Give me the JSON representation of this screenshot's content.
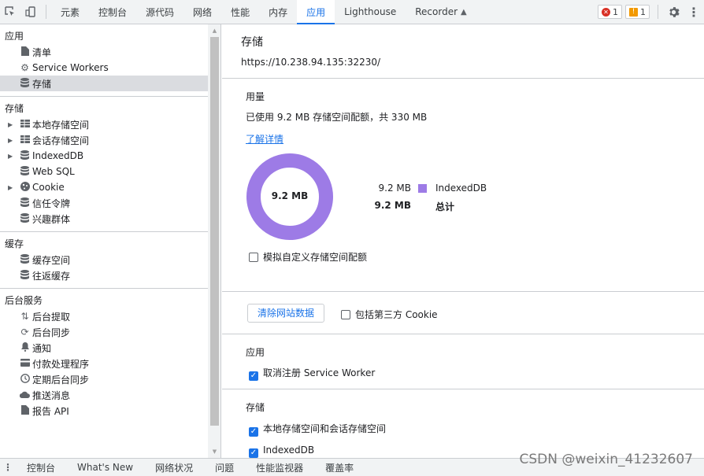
{
  "toolbar": {
    "tabs": [
      "元素",
      "控制台",
      "源代码",
      "网络",
      "性能",
      "内存",
      "应用",
      "Lighthouse",
      "Recorder"
    ],
    "active_tab": "应用",
    "error_count": "1",
    "warning_count": "1"
  },
  "sidebar": {
    "app_section": {
      "title": "应用",
      "items": [
        "清单",
        "Service Workers",
        "存储"
      ]
    },
    "storage_section": {
      "title": "存储",
      "items": [
        "本地存储空间",
        "会话存储空间",
        "IndexedDB",
        "Web SQL",
        "Cookie",
        "信任令牌",
        "兴趣群体"
      ]
    },
    "cache_section": {
      "title": "缓存",
      "items": [
        "缓存空间",
        "往返缓存"
      ]
    },
    "background_section": {
      "title": "后台服务",
      "items": [
        "后台提取",
        "后台同步",
        "通知",
        "付款处理程序",
        "定期后台同步",
        "推送消息",
        "报告 API"
      ]
    }
  },
  "main": {
    "title": "存储",
    "origin": "https://10.238.94.135:32230/",
    "usage": {
      "title": "用量",
      "summary": "已使用 9.2 MB 存储空间配额，共 330 MB",
      "learn_more": "了解详情",
      "donut_label": "9.2 MB",
      "legend_value": "9.2 MB",
      "legend_name": "IndexedDB",
      "total_value": "9.2 MB",
      "total_label": "总计",
      "simulate_quota": "模拟自定义存储空间配额"
    },
    "clear": {
      "button": "清除网站数据",
      "include_third_party": "包括第三方 Cookie"
    },
    "application": {
      "title": "应用",
      "unregister_sw": "取消注册 Service Worker"
    },
    "storage": {
      "title": "存储",
      "local_session": "本地存储空间和会话存储空间",
      "indexeddb": "IndexedDB"
    }
  },
  "drawer": {
    "tabs": [
      "控制台",
      "What's New",
      "网络状况",
      "问题",
      "性能监视器",
      "覆盖率"
    ]
  },
  "watermark": "CSDN @weixin_41232607",
  "colors": {
    "accent": "#1a73e8",
    "indexeddb": "#9d7be6"
  }
}
